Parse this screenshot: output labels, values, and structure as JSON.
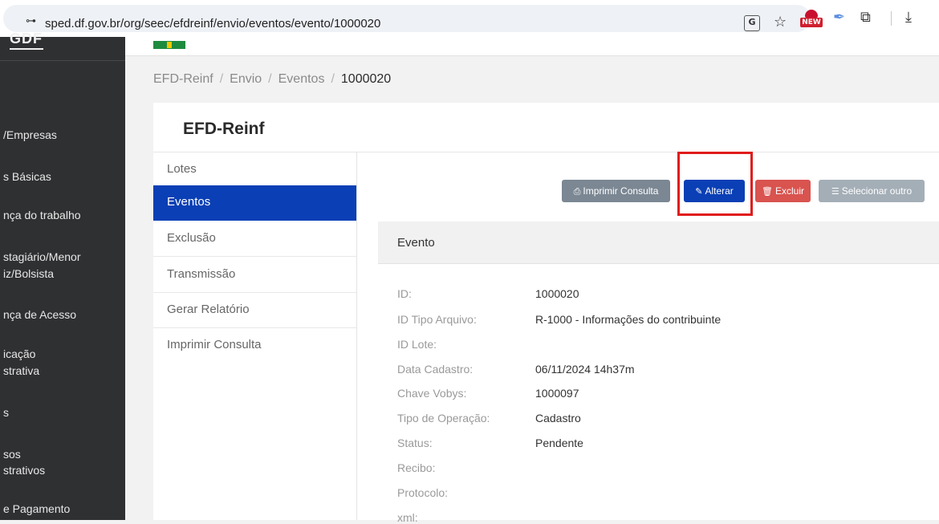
{
  "browser": {
    "site_icon": "⊶",
    "url": "sped.df.gov.br/org/seec/efdreinf/envio/eventos/evento/1000020",
    "translate_icon": "G",
    "star_icon": "☆",
    "new_badge": "NEW",
    "feather_icon": "✒",
    "puzzle_icon": "⧉",
    "download_icon": "⤓"
  },
  "sidebar": {
    "logo": "GDF",
    "items": [
      "/Empresas",
      "s Básicas",
      "nça do trabalho",
      "stagiário/Menor",
      "iz/Bolsista",
      "nça de Acesso",
      "icação",
      "strativa",
      "s",
      "sos",
      "strativos",
      "e Pagamento"
    ]
  },
  "breadcrumb": {
    "items": [
      "EFD-Reinf",
      "Envio",
      "Eventos"
    ],
    "separator": "/",
    "current": "1000020"
  },
  "card": {
    "title": "EFD-Reinf"
  },
  "menu": {
    "items": [
      "Lotes",
      "Eventos",
      "Exclusão",
      "Transmissão",
      "Gerar Relatório",
      "Imprimir Consulta"
    ],
    "active": "Eventos"
  },
  "toolbar": {
    "print_label": "Imprimir Consulta",
    "alter_label": "Alterar",
    "delete_label": "Excluir",
    "select_label": "Selecionar outro",
    "print_icon": "⎙",
    "alter_icon": "✎",
    "delete_icon": "🗑",
    "select_icon": "☰"
  },
  "event": {
    "title": "Evento",
    "fields": [
      {
        "label": "ID:",
        "value": "1000020"
      },
      {
        "label": "ID Tipo Arquivo:",
        "value": "R-1000 - Informações do contribuinte"
      },
      {
        "label": "ID Lote:",
        "value": ""
      },
      {
        "label": "Data Cadastro:",
        "value": "06/11/2024 14h37m"
      },
      {
        "label": "Chave Vobys:",
        "value": "1000097"
      },
      {
        "label": "Tipo de Operação:",
        "value": "Cadastro"
      },
      {
        "label": "Status:",
        "value": "Pendente"
      },
      {
        "label": "Recibo:",
        "value": ""
      },
      {
        "label": "Protocolo:",
        "value": ""
      },
      {
        "label": "xml:",
        "value": ""
      }
    ]
  },
  "colors": {
    "primary": "#0a3fb5",
    "danger": "#d9534f",
    "highlight": "#e01b1b",
    "sidebar": "#2f3032"
  }
}
